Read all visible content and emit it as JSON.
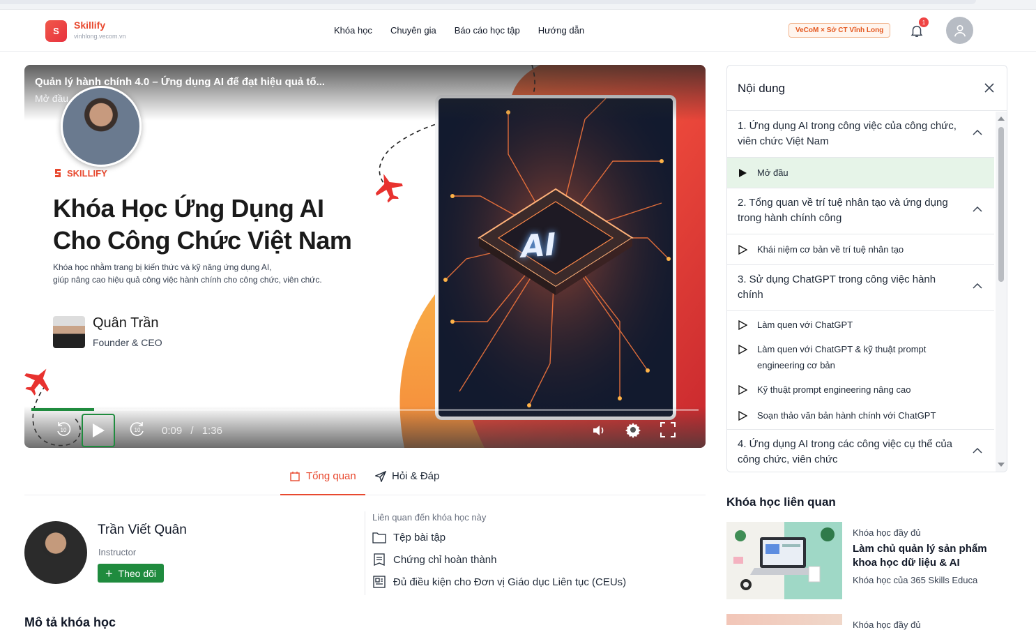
{
  "brand": {
    "logo_letter": "S",
    "name": "Skillify",
    "domain": "vinhlong.vecom.vn"
  },
  "nav": [
    "Khóa học",
    "Chuyên gia",
    "Báo cáo học tập",
    "Hướng dẫn"
  ],
  "partner_badge": "VeCoM × Sở CT Vĩnh Long",
  "notifications": {
    "count": "1"
  },
  "video": {
    "title": "Quản lý hành chính 4.0 – Ứng dụng AI để đạt hiệu quả tố...",
    "subtitle": "Mở đầu",
    "brand": "SKILLIFY",
    "heading_line1": "Khóa Học Ứng Dụng AI",
    "heading_line2": "Cho Công Chức Việt Nam",
    "desc_line1": "Khóa học nhằm trang bị kiến thức và kỹ năng ứng dụng AI,",
    "desc_line2": "giúp nâng cao hiệu quả công việc hành chính cho công chức, viên chức.",
    "instructor_name": "Quân Trần",
    "instructor_role": "Founder & CEO",
    "chip_text": "AI",
    "current_time": "0:09",
    "separator": "/",
    "duration": "1:36",
    "progress_fraction": 0.094,
    "skip_back": "10",
    "skip_forward": "10"
  },
  "tabs": [
    {
      "label": "Tổng quan",
      "icon": "overview-icon",
      "active": true
    },
    {
      "label": "Hỏi & Đáp",
      "icon": "send-icon",
      "active": false
    }
  ],
  "instructor": {
    "name": "Trần Viết Quân",
    "role": "Instructor",
    "follow_label": "Theo dõi"
  },
  "related_info": {
    "heading": "Liên quan đến khóa học này",
    "items": [
      {
        "icon": "folder-icon",
        "label": "Tệp bài tập"
      },
      {
        "icon": "certificate-icon",
        "label": "Chứng chỉ hoàn thành"
      },
      {
        "icon": "ceu-icon",
        "label": "Đủ điều kiện cho Đơn vị Giáo dục Liên tục (CEUs)"
      }
    ]
  },
  "description_heading": "Mô tả khóa học",
  "content_panel": {
    "title": "Nội dung",
    "sections": [
      {
        "title": "1. Ứng dụng AI trong công việc của công chức, viên chức Việt Nam",
        "lessons": [
          {
            "label": "Mở đầu",
            "active": true
          }
        ]
      },
      {
        "title": "2. Tổng quan về trí tuệ nhân tạo và ứng dụng trong hành chính công",
        "lessons": [
          {
            "label": "Khái niệm cơ bản về trí tuệ nhân tạo",
            "active": false
          }
        ]
      },
      {
        "title": "3. Sử dụng ChatGPT trong công việc hành chính",
        "lessons": [
          {
            "label": "Làm quen với ChatGPT",
            "active": false
          },
          {
            "label": "Làm quen với ChatGPT & kỹ thuật prompt engineering cơ bản",
            "active": false
          },
          {
            "label": "Kỹ thuật prompt engineering nâng cao",
            "active": false
          },
          {
            "label": "Soạn thảo văn bản hành chính với ChatGPT",
            "active": false
          }
        ]
      },
      {
        "title": "4. Ứng dụng AI trong các công việc cụ thể của công chức, viên chức",
        "lessons": []
      }
    ]
  },
  "related_courses": {
    "heading": "Khóa học liên quan",
    "items": [
      {
        "kind": "Khóa học đầy đủ",
        "title": "Làm chủ quản lý sản phẩm khoa học dữ liệu & AI",
        "by": "Khóa học của 365 Skills Educa"
      },
      {
        "kind": "Khóa học đầy đủ",
        "title": "",
        "by": ""
      }
    ]
  },
  "colors": {
    "accent": "#e8492f",
    "green": "#1f8b3e",
    "active_lesson_bg": "#e6f4e8"
  }
}
